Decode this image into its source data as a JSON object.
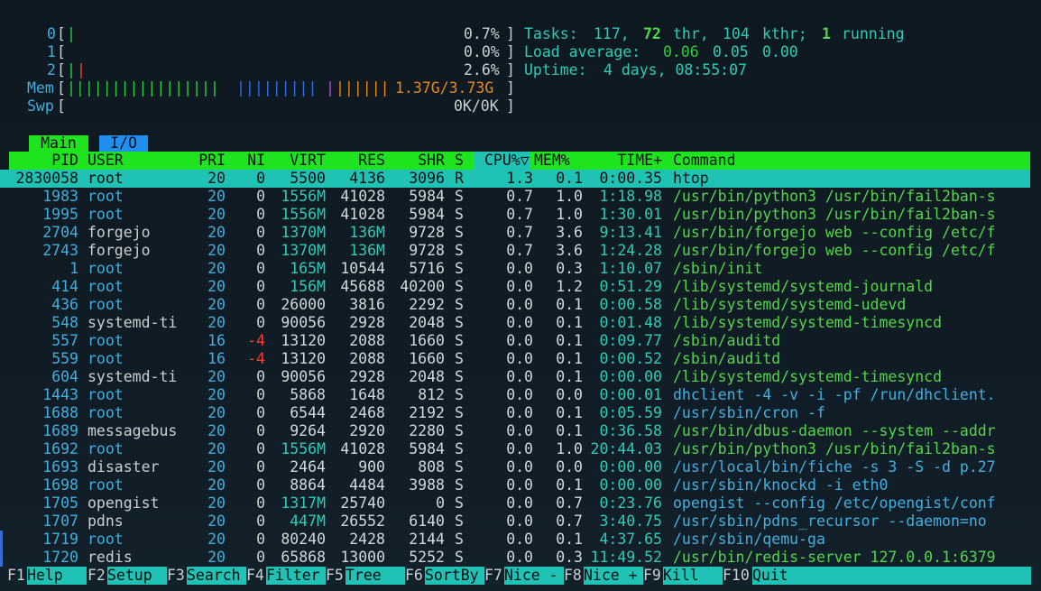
{
  "cpus": [
    {
      "label": "0",
      "percent": "0.7%"
    },
    {
      "label": "1",
      "percent": "0.0%"
    },
    {
      "label": "2",
      "percent": "2.6%"
    }
  ],
  "mem": {
    "label": "Mem",
    "value": "1.37G/3.73G"
  },
  "swp": {
    "label": "Swp",
    "value": "0K/0K"
  },
  "info": {
    "tasks_label": "Tasks:",
    "tasks": "117,",
    "thr": "72",
    "thr_label": "thr,",
    "kthr": "104",
    "kthr_label": "kthr;",
    "running": "1",
    "running_label": "running",
    "load_label": "Load average:",
    "load1": "0.06",
    "load5": "0.05",
    "load15": "0.00",
    "uptime_label": "Uptime:",
    "uptime": "4 days, 08:55:07"
  },
  "tabs": {
    "main": "Main",
    "io": "I/O"
  },
  "columns": {
    "pid": "PID",
    "user": "USER",
    "pri": "PRI",
    "ni": "NI",
    "virt": "VIRT",
    "res": "RES",
    "shr": "SHR",
    "s": "S",
    "cpu": "CPU%▽",
    "mem": "MEM%",
    "time": "TIME+",
    "command": "Command"
  },
  "processes": [
    {
      "pid": "2830058",
      "user": "root",
      "pri": "20",
      "ni": "0",
      "virt": "5500",
      "res": "4136",
      "shr": "3096",
      "s": "R",
      "cpu": "1.3",
      "mem": "0.1",
      "time": "0:00.35",
      "command": "htop"
    },
    {
      "pid": "1983",
      "user": "root",
      "pri": "20",
      "ni": "0",
      "virt": "1556M",
      "res": "41028",
      "shr": "5984",
      "s": "S",
      "cpu": "0.7",
      "mem": "1.0",
      "time": "1:18.98",
      "command": "/usr/bin/python3 /usr/bin/fail2ban-s"
    },
    {
      "pid": "1995",
      "user": "root",
      "pri": "20",
      "ni": "0",
      "virt": "1556M",
      "res": "41028",
      "shr": "5984",
      "s": "S",
      "cpu": "0.7",
      "mem": "1.0",
      "time": "1:30.01",
      "command": "/usr/bin/python3 /usr/bin/fail2ban-s"
    },
    {
      "pid": "2704",
      "user": "forgejo",
      "pri": "20",
      "ni": "0",
      "virt": "1370M",
      "res": "136M",
      "shr": "9728",
      "s": "S",
      "cpu": "0.7",
      "mem": "3.6",
      "time": "9:13.41",
      "command": "/usr/bin/forgejo web --config /etc/f"
    },
    {
      "pid": "2743",
      "user": "forgejo",
      "pri": "20",
      "ni": "0",
      "virt": "1370M",
      "res": "136M",
      "shr": "9728",
      "s": "S",
      "cpu": "0.7",
      "mem": "3.6",
      "time": "1:24.28",
      "command": "/usr/bin/forgejo web --config /etc/f"
    },
    {
      "pid": "1",
      "user": "root",
      "pri": "20",
      "ni": "0",
      "virt": "165M",
      "res": "10544",
      "shr": "5716",
      "s": "S",
      "cpu": "0.0",
      "mem": "0.3",
      "time": "1:10.07",
      "command": "/sbin/init"
    },
    {
      "pid": "414",
      "user": "root",
      "pri": "20",
      "ni": "0",
      "virt": "156M",
      "res": "45688",
      "shr": "40200",
      "s": "S",
      "cpu": "0.0",
      "mem": "1.2",
      "time": "0:51.29",
      "command": "/lib/systemd/systemd-journald"
    },
    {
      "pid": "436",
      "user": "root",
      "pri": "20",
      "ni": "0",
      "virt": "26000",
      "res": "3816",
      "shr": "2292",
      "s": "S",
      "cpu": "0.0",
      "mem": "0.1",
      "time": "0:00.58",
      "command": "/lib/systemd/systemd-udevd"
    },
    {
      "pid": "548",
      "user": "systemd-ti",
      "pri": "20",
      "ni": "0",
      "virt": "90056",
      "res": "2928",
      "shr": "2048",
      "s": "S",
      "cpu": "0.0",
      "mem": "0.1",
      "time": "0:01.48",
      "command": "/lib/systemd/systemd-timesyncd"
    },
    {
      "pid": "557",
      "user": "root",
      "pri": "16",
      "ni": "-4",
      "virt": "13120",
      "res": "2088",
      "shr": "1660",
      "s": "S",
      "cpu": "0.0",
      "mem": "0.1",
      "time": "0:09.77",
      "command": "/sbin/auditd"
    },
    {
      "pid": "559",
      "user": "root",
      "pri": "16",
      "ni": "-4",
      "virt": "13120",
      "res": "2088",
      "shr": "1660",
      "s": "S",
      "cpu": "0.0",
      "mem": "0.1",
      "time": "0:00.52",
      "command": "/sbin/auditd"
    },
    {
      "pid": "604",
      "user": "systemd-ti",
      "pri": "20",
      "ni": "0",
      "virt": "90056",
      "res": "2928",
      "shr": "2048",
      "s": "S",
      "cpu": "0.0",
      "mem": "0.1",
      "time": "0:00.00",
      "command": "/lib/systemd/systemd-timesyncd"
    },
    {
      "pid": "1443",
      "user": "root",
      "pri": "20",
      "ni": "0",
      "virt": "5868",
      "res": "1648",
      "shr": "812",
      "s": "S",
      "cpu": "0.0",
      "mem": "0.0",
      "time": "0:00.01",
      "command": "dhclient -4 -v -i -pf /run/dhclient."
    },
    {
      "pid": "1688",
      "user": "root",
      "pri": "20",
      "ni": "0",
      "virt": "6544",
      "res": "2468",
      "shr": "2192",
      "s": "S",
      "cpu": "0.0",
      "mem": "0.1",
      "time": "0:05.59",
      "command": "/usr/sbin/cron -f"
    },
    {
      "pid": "1689",
      "user": "messagebus",
      "pri": "20",
      "ni": "0",
      "virt": "9264",
      "res": "2920",
      "shr": "2280",
      "s": "S",
      "cpu": "0.0",
      "mem": "0.1",
      "time": "0:36.58",
      "command": "/usr/bin/dbus-daemon --system --addr"
    },
    {
      "pid": "1692",
      "user": "root",
      "pri": "20",
      "ni": "0",
      "virt": "1556M",
      "res": "41028",
      "shr": "5984",
      "s": "S",
      "cpu": "0.0",
      "mem": "1.0",
      "time": "20:44.03",
      "command": "/usr/bin/python3 /usr/bin/fail2ban-s"
    },
    {
      "pid": "1693",
      "user": "disaster",
      "pri": "20",
      "ni": "0",
      "virt": "2464",
      "res": "900",
      "shr": "808",
      "s": "S",
      "cpu": "0.0",
      "mem": "0.0",
      "time": "0:00.00",
      "command": "/usr/local/bin/fiche -s 3 -S -d p.27"
    },
    {
      "pid": "1698",
      "user": "root",
      "pri": "20",
      "ni": "0",
      "virt": "8864",
      "res": "4484",
      "shr": "3988",
      "s": "S",
      "cpu": "0.0",
      "mem": "0.1",
      "time": "0:00.00",
      "command": "/usr/sbin/knockd -i eth0"
    },
    {
      "pid": "1705",
      "user": "opengist",
      "pri": "20",
      "ni": "0",
      "virt": "1317M",
      "res": "25740",
      "shr": "0",
      "s": "S",
      "cpu": "0.0",
      "mem": "0.7",
      "time": "0:23.76",
      "command": "opengist --config /etc/opengist/conf"
    },
    {
      "pid": "1707",
      "user": "pdns",
      "pri": "20",
      "ni": "0",
      "virt": "447M",
      "res": "26552",
      "shr": "6140",
      "s": "S",
      "cpu": "0.0",
      "mem": "0.7",
      "time": "3:40.75",
      "command": "/usr/sbin/pdns_recursor --daemon=no"
    },
    {
      "pid": "1719",
      "user": "root",
      "pri": "20",
      "ni": "0",
      "virt": "80240",
      "res": "2428",
      "shr": "2144",
      "s": "S",
      "cpu": "0.0",
      "mem": "0.1",
      "time": "4:37.65",
      "command": "/usr/sbin/qemu-ga"
    },
    {
      "pid": "1720",
      "user": "redis",
      "pri": "20",
      "ni": "0",
      "virt": "65868",
      "res": "13000",
      "shr": "5252",
      "s": "S",
      "cpu": "0.0",
      "mem": "0.3",
      "time": "11:49.52",
      "command": "/usr/bin/redis-server 127.0.0.1:6379"
    }
  ],
  "footer": [
    {
      "key": "F1",
      "label": "Help"
    },
    {
      "key": "F2",
      "label": "Setup"
    },
    {
      "key": "F3",
      "label": "Search"
    },
    {
      "key": "F4",
      "label": "Filter"
    },
    {
      "key": "F5",
      "label": "Tree"
    },
    {
      "key": "F6",
      "label": "SortBy"
    },
    {
      "key": "F7",
      "label": "Nice -"
    },
    {
      "key": "F8",
      "label": "Nice +"
    },
    {
      "key": "F9",
      "label": "Kill"
    },
    {
      "key": "F10",
      "label": "Quit"
    }
  ]
}
